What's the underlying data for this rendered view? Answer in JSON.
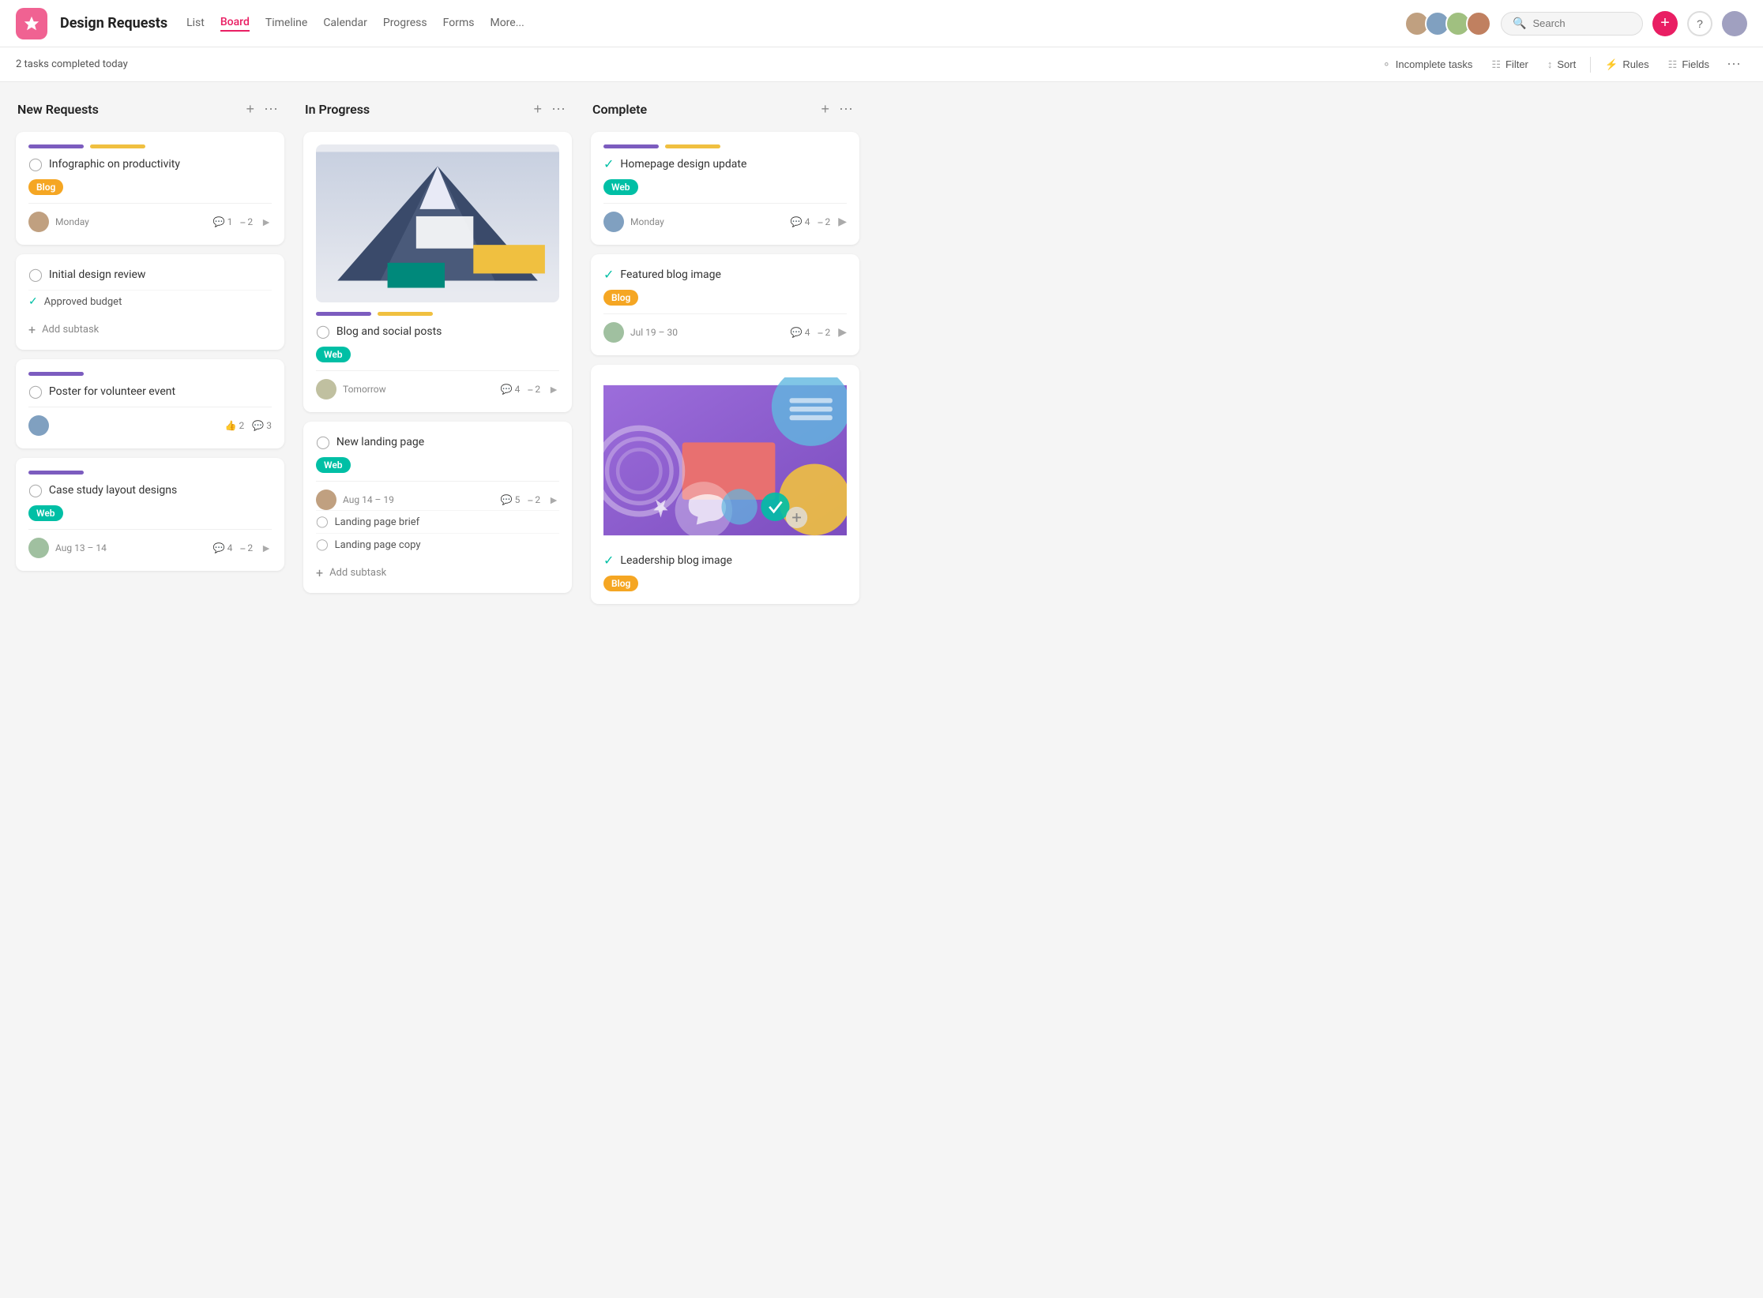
{
  "app": {
    "title": "Design Requests",
    "logo_char": "★"
  },
  "nav": {
    "items": [
      {
        "label": "List",
        "active": false
      },
      {
        "label": "Board",
        "active": true
      },
      {
        "label": "Timeline",
        "active": false
      },
      {
        "label": "Calendar",
        "active": false
      },
      {
        "label": "Progress",
        "active": false
      },
      {
        "label": "Forms",
        "active": false
      },
      {
        "label": "More...",
        "active": false
      }
    ]
  },
  "subheader": {
    "tasks_completed": "2 tasks completed today",
    "incomplete_tasks": "Incomplete tasks",
    "filter": "Filter",
    "sort": "Sort",
    "rules": "Rules",
    "fields": "Fields"
  },
  "columns": [
    {
      "title": "New Requests",
      "cards": [
        {
          "id": "infographic",
          "title": "Infographic on productivity",
          "tag": "Blog",
          "tag_type": "orange",
          "date": "Monday",
          "comments": "1",
          "subtasks": "2",
          "has_arrow": true,
          "avatar": "av1"
        },
        {
          "id": "initial-design",
          "title": "Initial design review",
          "subtask_label": "Approved budget",
          "add_subtask": "Add subtask"
        },
        {
          "id": "poster",
          "title": "Poster for volunteer event",
          "likes": "2",
          "comments": "3",
          "avatar": "av2"
        },
        {
          "id": "case-study",
          "title": "Case study layout designs",
          "tag": "Web",
          "tag_type": "teal",
          "date": "Aug 13 – 14",
          "comments": "4",
          "subtasks": "2",
          "has_arrow": true,
          "avatar": "av3"
        }
      ]
    },
    {
      "title": "In Progress",
      "cards": [
        {
          "id": "blog-social",
          "title": "Blog and social posts",
          "tag": "Web",
          "tag_type": "teal",
          "date": "Tomorrow",
          "comments": "4",
          "subtasks": "2",
          "has_arrow": true,
          "avatar": "av4",
          "has_image": true
        },
        {
          "id": "new-landing",
          "title": "New landing page",
          "tag": "Web",
          "tag_type": "teal",
          "date": "Aug 14 – 19",
          "comments": "5",
          "subtasks": "2",
          "has_arrow": true,
          "avatar": "av1",
          "subtasks_list": [
            "Landing page brief",
            "Landing page copy"
          ],
          "add_subtask": "Add subtask"
        }
      ]
    },
    {
      "title": "Complete",
      "cards": [
        {
          "id": "homepage",
          "title": "Homepage design update",
          "tag": "Web",
          "tag_type": "teal",
          "date": "Monday",
          "comments": "4",
          "subtasks": "2",
          "has_arrow": true,
          "avatar": "av2",
          "done": true
        },
        {
          "id": "featured-blog",
          "title": "Featured blog image",
          "tag": "Blog",
          "tag_type": "orange",
          "date": "Jul 19 – 30",
          "comments": "4",
          "subtasks": "2",
          "has_arrow": true,
          "avatar": "av3",
          "done": true
        },
        {
          "id": "leadership-blog",
          "title": "Leadership blog image",
          "tag": "Blog",
          "tag_type": "orange",
          "done": true,
          "has_design_image": true
        }
      ]
    }
  ]
}
